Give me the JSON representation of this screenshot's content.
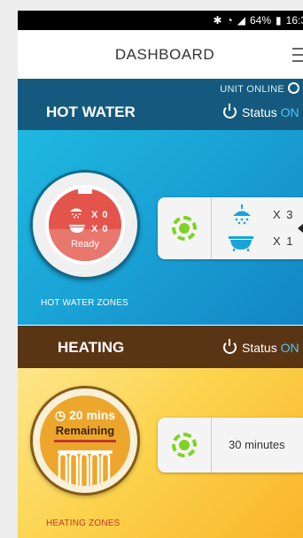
{
  "status_bar": {
    "battery": "64%",
    "time": "16:3"
  },
  "app_bar": {
    "title": "DASHBOARD"
  },
  "hot_water": {
    "unit_status": "UNIT ONLINE",
    "title": "HOT WATER",
    "status_label": "Status",
    "status_value": "ON",
    "tank": {
      "shower_count": "X 0",
      "bath_count": "X 0",
      "state": "Ready"
    },
    "zones_label": "HOT WATER ZONES",
    "zone_card": {
      "shower_count": "X 3",
      "bath_count": "X 1"
    }
  },
  "heating": {
    "title": "HEATING",
    "status_label": "Status",
    "status_value": "ON",
    "timer": {
      "time": "20 mins",
      "label": "Remaining"
    },
    "zones_label": "HEATING ZONES",
    "zone_card": {
      "duration": "30 minutes"
    }
  },
  "colors": {
    "accent": "#4fc3f7",
    "indicator": "#7ed321",
    "hot_water_band": "#155a7e",
    "heating_band": "#5a3514"
  }
}
